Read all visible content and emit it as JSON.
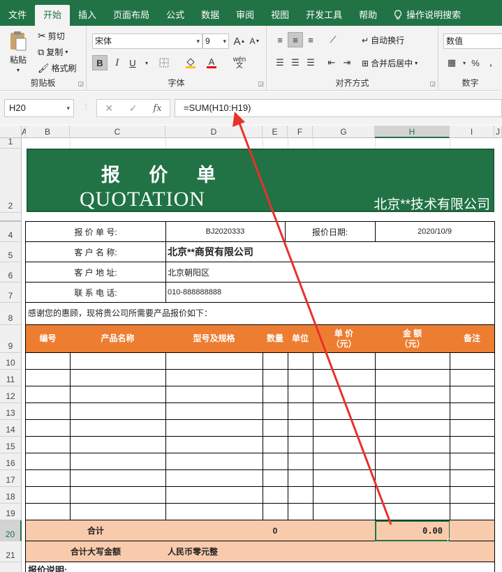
{
  "ribbon_tabs": [
    "文件",
    "开始",
    "插入",
    "页面布局",
    "公式",
    "数据",
    "审阅",
    "视图",
    "开发工具",
    "帮助"
  ],
  "search_label": "操作说明搜索",
  "clipboard": {
    "paste": "粘贴",
    "cut": "剪切",
    "copy": "复制",
    "format_painter": "格式刷",
    "label": "剪贴板"
  },
  "font": {
    "name": "宋体",
    "size": "9",
    "bold": "B",
    "italic": "I",
    "underline": "U",
    "grow": "A",
    "shrink": "A",
    "font_color": "A",
    "wen": "wén",
    "label": "字体"
  },
  "alignment": {
    "wrap": "自动换行",
    "merge": "合并后居中",
    "label": "对齐方式"
  },
  "number": {
    "format": "数值",
    "percent": "%",
    "label": "数字"
  },
  "formula_bar": {
    "name_box": "H20",
    "fx": "fx",
    "formula": "=SUM(H10:H19)"
  },
  "columns": [
    "A",
    "B",
    "C",
    "D",
    "E",
    "F",
    "G",
    "H",
    "I",
    "J"
  ],
  "rows": [
    "1",
    "2",
    "4",
    "5",
    "6",
    "7",
    "8",
    "9",
    "10",
    "11",
    "12",
    "13",
    "14",
    "15",
    "16",
    "17",
    "18",
    "19",
    "20",
    "21"
  ],
  "sheet": {
    "title_cn": "报 价 单",
    "title_en": "QUOTATION",
    "company": "北京**技术有限公司",
    "quote_no_label": "报 价 单 号:",
    "quote_no": "BJ2020333",
    "quote_date_label": "报价日期:",
    "quote_date": "2020/10/9",
    "customer_label": "客 户 名 称:",
    "customer": "北京**商贸有限公司",
    "address_label": "客 户 地 址:",
    "address": "北京朝阳区",
    "phone_label": "联 系 电 话:",
    "phone": "010-888888888",
    "thanks": "感谢您的惠顾，现将贵公司所需要产品报价如下：",
    "headers": {
      "no": "编号",
      "product": "产品名称",
      "model": "型号及规格",
      "qty": "数量",
      "unit": "单位",
      "price_1": "单  价",
      "price_2": "（元）",
      "amount_1": "金  额",
      "amount_2": "（元）",
      "remark": "备注"
    },
    "total_label": "合计",
    "total_qty": "0",
    "total_amount": "0.00",
    "total_words_label": "合计大写金额",
    "total_words": "人民币零元整",
    "notes_label": "报价说明:"
  },
  "colors": {
    "excel_green": "#217346",
    "header_orange": "#ed7d31",
    "total_peach": "#f8cbad",
    "arrow_red": "#e8312a"
  }
}
